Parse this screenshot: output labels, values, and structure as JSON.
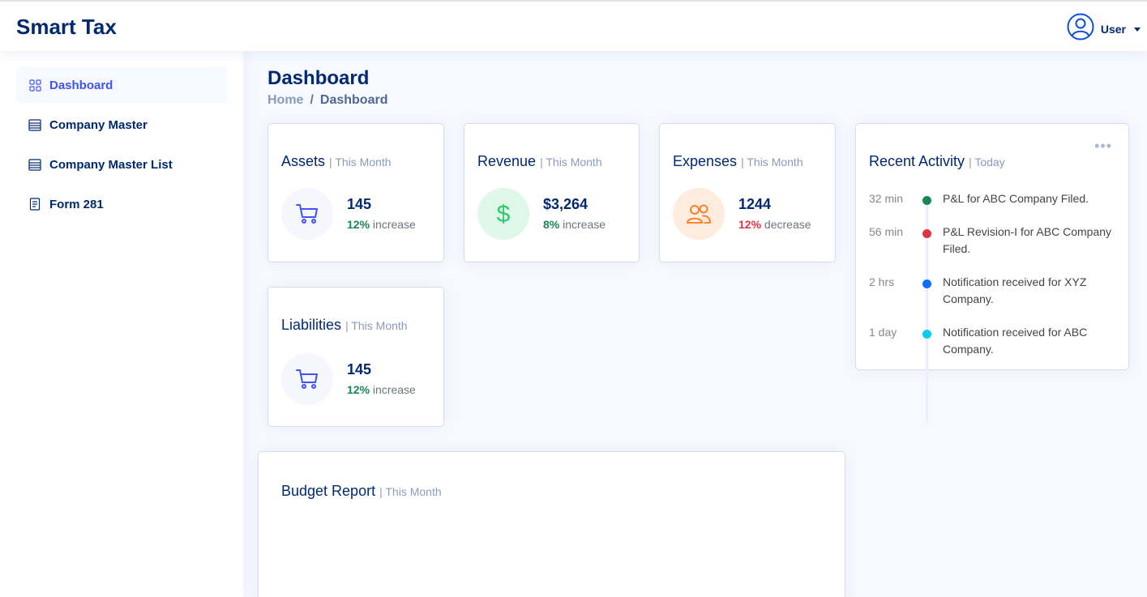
{
  "app": {
    "brand": "Smart Tax",
    "user_label": "User"
  },
  "sidebar": {
    "items": [
      {
        "label": "Dashboard",
        "icon": "grid-icon",
        "active": true
      },
      {
        "label": "Company Master",
        "icon": "list-icon"
      },
      {
        "label": "Company Master List",
        "icon": "list-icon"
      },
      {
        "label": "Form 281",
        "icon": "document-icon"
      }
    ]
  },
  "page": {
    "title": "Dashboard",
    "breadcrumb": {
      "home": "Home",
      "separator": "/",
      "current": "Dashboard"
    }
  },
  "cards": {
    "assets": {
      "title": "Assets",
      "period": "| This Month",
      "value": "145",
      "pct": "12%",
      "trend": "increase",
      "icon": "cart-icon"
    },
    "revenue": {
      "title": "Revenue",
      "period": "| This Month",
      "value": "$3,264",
      "pct": "8%",
      "trend": "increase",
      "icon": "dollar-icon"
    },
    "expenses": {
      "title": "Expenses",
      "period": "| This Month",
      "value": "1244",
      "pct": "12%",
      "trend": "decrease",
      "icon": "people-icon"
    },
    "liabilities": {
      "title": "Liabilities",
      "period": "| This Month",
      "value": "145",
      "pct": "12%",
      "trend": "increase",
      "icon": "cart-icon"
    }
  },
  "activity": {
    "title": "Recent Activity",
    "period": "| Today",
    "items": [
      {
        "time": "32 min",
        "text": "P&L for ABC Company Filed.",
        "color": "#198754"
      },
      {
        "time": "56 min",
        "text": "P&L Revision-I for ABC Company Filed.",
        "color": "#dc3545"
      },
      {
        "time": "2 hrs",
        "text": "Notification received for XYZ Company.",
        "color": "#0d6efd"
      },
      {
        "time": "1 day",
        "text": "Notification received for ABC Company.",
        "color": "#0dcaf0"
      }
    ]
  },
  "budget": {
    "title": "Budget Report",
    "period": "| This Month"
  },
  "colors": {
    "primary": "#012970",
    "accent": "#4154f1",
    "green": "#198754",
    "red": "#dc3545",
    "muted": "#899bbd"
  }
}
